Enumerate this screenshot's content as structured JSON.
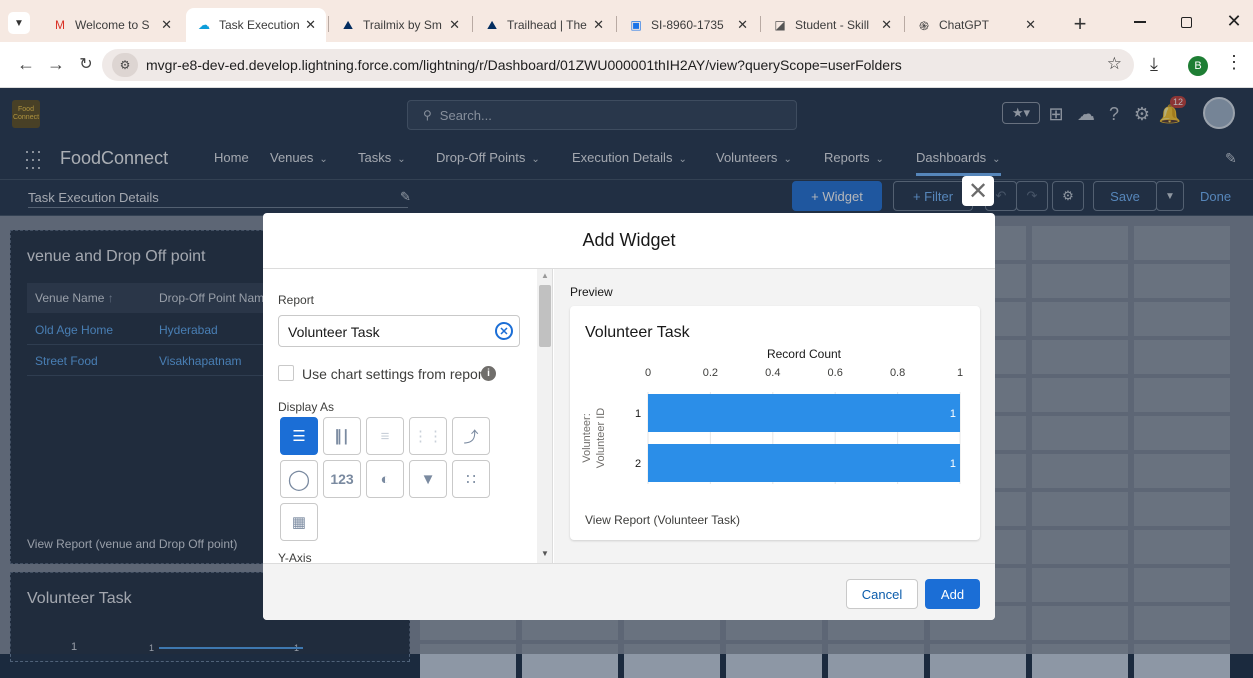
{
  "browser": {
    "tabs": [
      {
        "title": "Welcome to S",
        "icon": "M",
        "color": "#d93025"
      },
      {
        "title": "Task Execution",
        "icon": "☁",
        "color": "#0d9dda"
      },
      {
        "title": "Trailmix by Sm",
        "icon": "⛰",
        "color": "#032d60"
      },
      {
        "title": "Trailhead | The",
        "icon": "⛰",
        "color": "#032d60"
      },
      {
        "title": "SI-8960-1735",
        "icon": "▣",
        "color": "#1a73e8"
      },
      {
        "title": "Student - Skill",
        "icon": "◪",
        "color": "#555555"
      },
      {
        "title": "ChatGPT",
        "icon": "֍",
        "color": "#333333"
      }
    ],
    "url": "mvgr-e8-dev-ed.develop.lightning.force.com/lightning/r/Dashboard/01ZWU000001thIH2AY/view?queryScope=userFolders",
    "profile_initial": "B"
  },
  "header": {
    "logo_text": "Food Connect",
    "search_placeholder": "Search...",
    "notification_count": "12"
  },
  "app": {
    "name": "FoodConnect",
    "nav": [
      {
        "label": "Home",
        "chevron": false
      },
      {
        "label": "Venues",
        "chevron": true
      },
      {
        "label": "Tasks",
        "chevron": true
      },
      {
        "label": "Drop-Off Points",
        "chevron": true
      },
      {
        "label": "Execution Details",
        "chevron": true
      },
      {
        "label": "Volunteers",
        "chevron": true
      },
      {
        "label": "Reports",
        "chevron": true
      },
      {
        "label": "Dashboards",
        "chevron": true
      }
    ]
  },
  "dashboard": {
    "title": "Task Execution Details",
    "widget_button": "+ Widget",
    "filter_button": "+ Filter",
    "save_button": "Save",
    "done_button": "Done",
    "widget1": {
      "title": "venue and Drop Off point",
      "col1": "Venue Name",
      "col1_sort": "↑",
      "col2": "Drop-Off Point Nam",
      "rows": [
        {
          "venue": "Old Age Home",
          "dropoff": "Hyderabad"
        },
        {
          "venue": "Street Food",
          "dropoff": "Visakhapatnam"
        }
      ],
      "footer": "View Report (venue and Drop Off point)"
    },
    "widget2": {
      "title": "Volunteer Task",
      "tick1": "1",
      "tick2": "1",
      "tick3": "1"
    }
  },
  "modal": {
    "title": "Add Widget",
    "report_label": "Report",
    "report_value": "Volunteer Task",
    "use_chart_settings_label": "Use chart settings from report",
    "display_as_label": "Display As",
    "metric_label": "123",
    "y_axis_label": "Y-Axis",
    "preview_label": "Preview",
    "cancel_label": "Cancel",
    "add_label": "Add"
  },
  "chart_data": {
    "type": "bar",
    "orientation": "horizontal",
    "title": "Volunteer Task",
    "xlabel": "Record Count",
    "ylabel": "Volunteer: Volunteer ID",
    "ylabel_line1": "Volunteer:",
    "ylabel_line2": "Volunteer ID",
    "categories": [
      "1",
      "2"
    ],
    "values": [
      1,
      1
    ],
    "data_labels": [
      "1",
      "1"
    ],
    "xlim": [
      0,
      1
    ],
    "xticks": [
      "0",
      "0.2",
      "0.4",
      "0.6",
      "0.8",
      "1"
    ],
    "bar_color": "#2b8ee8",
    "footer": "View Report (Volunteer Task)"
  },
  "colors": {
    "accent": "#1b6ed6",
    "header_bg": "#1e3149",
    "notification": "#c23934"
  }
}
